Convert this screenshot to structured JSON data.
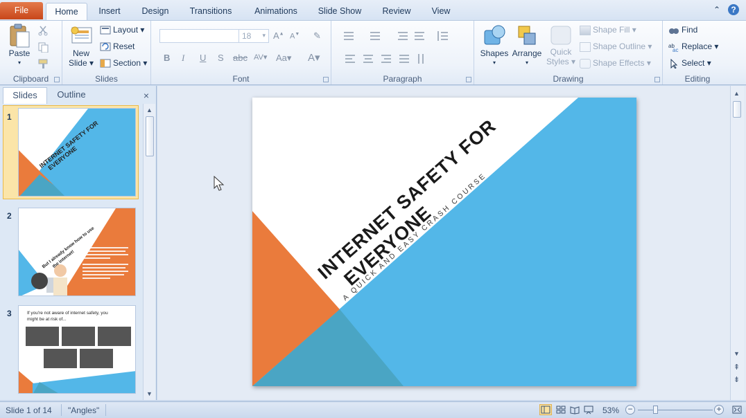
{
  "tabs": [
    {
      "label": "File"
    },
    {
      "label": "Home"
    },
    {
      "label": "Insert"
    },
    {
      "label": "Design"
    },
    {
      "label": "Transitions"
    },
    {
      "label": "Animations"
    },
    {
      "label": "Slide Show"
    },
    {
      "label": "Review"
    },
    {
      "label": "View"
    }
  ],
  "ribbon": {
    "clipboard": {
      "label": "Clipboard",
      "paste": "Paste"
    },
    "slides": {
      "label": "Slides",
      "new_slide_1": "New",
      "new_slide_2": "Slide",
      "layout": "Layout",
      "reset": "Reset",
      "section": "Section"
    },
    "font": {
      "label": "Font",
      "size": "18"
    },
    "paragraph": {
      "label": "Paragraph"
    },
    "drawing": {
      "label": "Drawing",
      "shapes": "Shapes",
      "arrange": "Arrange",
      "quick_styles_1": "Quick",
      "quick_styles_2": "Styles",
      "shape_fill": "Shape Fill",
      "shape_outline": "Shape Outline",
      "shape_effects": "Shape Effects"
    },
    "editing": {
      "label": "Editing",
      "find": "Find",
      "replace": "Replace",
      "select": "Select"
    }
  },
  "pane": {
    "tabs": [
      {
        "label": "Slides"
      },
      {
        "label": "Outline"
      }
    ],
    "close": "×",
    "thumbs": [
      {
        "num": "1",
        "title_1": "INTERNET SAFETY FOR",
        "title_2": "EVERYONE"
      },
      {
        "num": "2",
        "heading_1": "But I already know how to use",
        "heading_2": "the internet!"
      },
      {
        "num": "3",
        "heading_1": "If you're not aware of internet safety, you",
        "heading_2": "might be at risk of..."
      }
    ]
  },
  "slide": {
    "title_line1": "INTERNET SAFETY FOR",
    "title_line2": "EVERYONE",
    "subtitle": "A QUICK AND EASY CRASH COURSE",
    "colors": {
      "orange": "#ea7b3c",
      "blue": "#53b7e8",
      "teal": "#4aa5c4"
    }
  },
  "status": {
    "slide_indicator": "Slide 1 of 14",
    "theme": "\"Angles\"",
    "zoom": "53%",
    "zoom_level": 0.53
  },
  "icons": [
    "minimize-ribbon-icon",
    "help-icon",
    "paste-icon",
    "cut-icon",
    "copy-icon",
    "format-painter-icon",
    "new-slide-icon",
    "shapes-icon",
    "arrange-icon",
    "find-icon",
    "replace-icon",
    "select-icon",
    "mouse-cursor-icon",
    "normal-view-icon",
    "slide-sorter-icon",
    "reading-view-icon",
    "slideshow-icon",
    "fit-window-icon"
  ]
}
